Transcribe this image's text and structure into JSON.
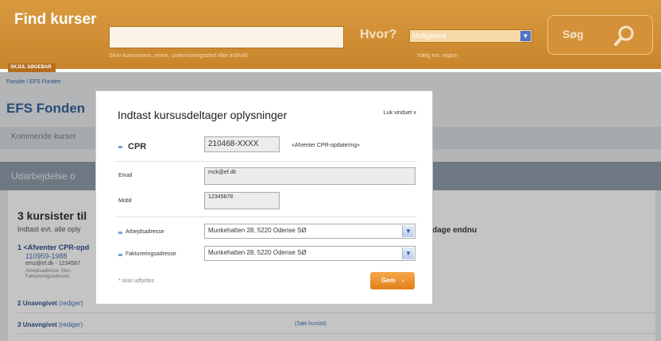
{
  "header": {
    "title": "Find kurser",
    "search_hint": "Skriv kursusnavn, emne, undervisningssted eller indhold",
    "location_label": "Hvor?",
    "region_value": "Midtjylland",
    "region_hint": "Vælg evt. region",
    "search_button": "Søg",
    "hide_search": "SKJUL SØGEBAR"
  },
  "page": {
    "breadcrumb": "Forside / EFS Fonden",
    "title": "EFS Fonden",
    "sub_nav": "Kommende kurser",
    "section_label": "Udarbejdelse o",
    "content_title": "3 kursister til",
    "content_sub": "Indtast evt. alle oply",
    "remaining": "dage endnu",
    "participants": [
      {
        "label": "1 <Afventer CPR-opd",
        "cpr": "110959-1988",
        "contact": "emz@ef.dk - 1234567",
        "addr1": "Arbejdsadresse: Mun",
        "addr2": "Faktureringsadresse:"
      },
      {
        "num": "2",
        "name": "Unavngivet",
        "edit": "(rediger)"
      },
      {
        "num": "3",
        "name": "Unavngivet",
        "edit": "(rediger)"
      }
    ],
    "set_participant": "(Sæt kursist)"
  },
  "modal": {
    "title": "Indtast kursusdeltager oplysninger",
    "close": "Luk vinduet x",
    "cpr_label": "CPR",
    "cpr_value": "210468-XXXX",
    "cpr_status": "«Afventer CPR-opdatering»",
    "email_label": "Email",
    "email_value": "mck@ef.dk",
    "mobil_label": "Mobil",
    "mobil_value": "12345678",
    "work_address_label": "Arbejdsadresse",
    "work_address_value": "Munkehatten 28, 5220 Odense SØ",
    "billing_address_label": "Faktureringsadresse",
    "billing_address_value": "Munkehatten 28, 5220 Odense SØ",
    "required_note": "* skal udfyldes",
    "save_button": "Gem"
  },
  "colors": {
    "header_orange": "#d99a3e",
    "link_blue": "#2c64a6",
    "save_orange": "#e2801a"
  }
}
